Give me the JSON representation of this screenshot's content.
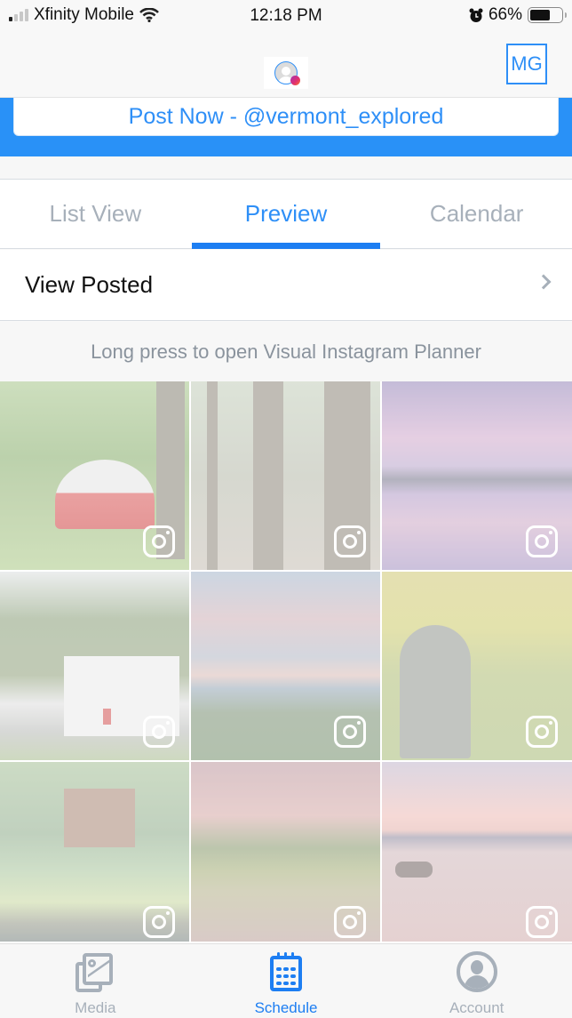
{
  "status_bar": {
    "carrier": "Xfinity Mobile",
    "time": "12:18 PM",
    "battery_percent": "66%",
    "battery_level": 0.66,
    "signal_bars": 1,
    "icons": [
      "signal-icon",
      "wifi-icon",
      "alarm-icon",
      "battery-icon"
    ]
  },
  "header": {
    "account_initials": "MG",
    "avatar_icon": "profile-avatar-icon",
    "avatar_badge_icon": "instagram-badge-icon"
  },
  "post_now": {
    "label": "Post Now - @vermont_explored"
  },
  "tabs": [
    {
      "label": "List View",
      "active": false
    },
    {
      "label": "Preview",
      "active": true
    },
    {
      "label": "Calendar",
      "active": false
    }
  ],
  "view_posted": {
    "label": "View Posted",
    "icon": "chevron-right-icon"
  },
  "hint": {
    "text": "Long press to open Visual Instagram Planner"
  },
  "grid": {
    "tiles": [
      {
        "subject": "Red tent in forest",
        "overlay_icon": "instagram-icon"
      },
      {
        "subject": "Forest trail with owl carving",
        "overlay_icon": "instagram-icon"
      },
      {
        "subject": "Purple sunset over lake with island",
        "overlay_icon": "instagram-icon"
      },
      {
        "subject": "White house with red door and trees",
        "overlay_icon": "instagram-icon"
      },
      {
        "subject": "Mountain view with windsock at dusk",
        "overlay_icon": "instagram-icon"
      },
      {
        "subject": "Statue of artist sketching near yellow bushes",
        "overlay_icon": "instagram-icon"
      },
      {
        "subject": "Treehouse by pond with fisherman",
        "overlay_icon": "instagram-icon"
      },
      {
        "subject": "Wooded hills reflected in river at sunset",
        "overlay_icon": "instagram-icon"
      },
      {
        "subject": "Dog running through lake at sunset",
        "overlay_icon": "instagram-icon"
      }
    ]
  },
  "tab_bar": {
    "items": [
      {
        "label": "Media",
        "icon": "media-icon",
        "active": false
      },
      {
        "label": "Schedule",
        "icon": "calendar-icon",
        "active": true
      },
      {
        "label": "Account",
        "icon": "account-icon",
        "active": false
      }
    ]
  },
  "colors": {
    "accent": "#2e8ff7",
    "band": "#2991f7",
    "inactive": "#a7b0ba",
    "hint_text": "#8a939d"
  }
}
